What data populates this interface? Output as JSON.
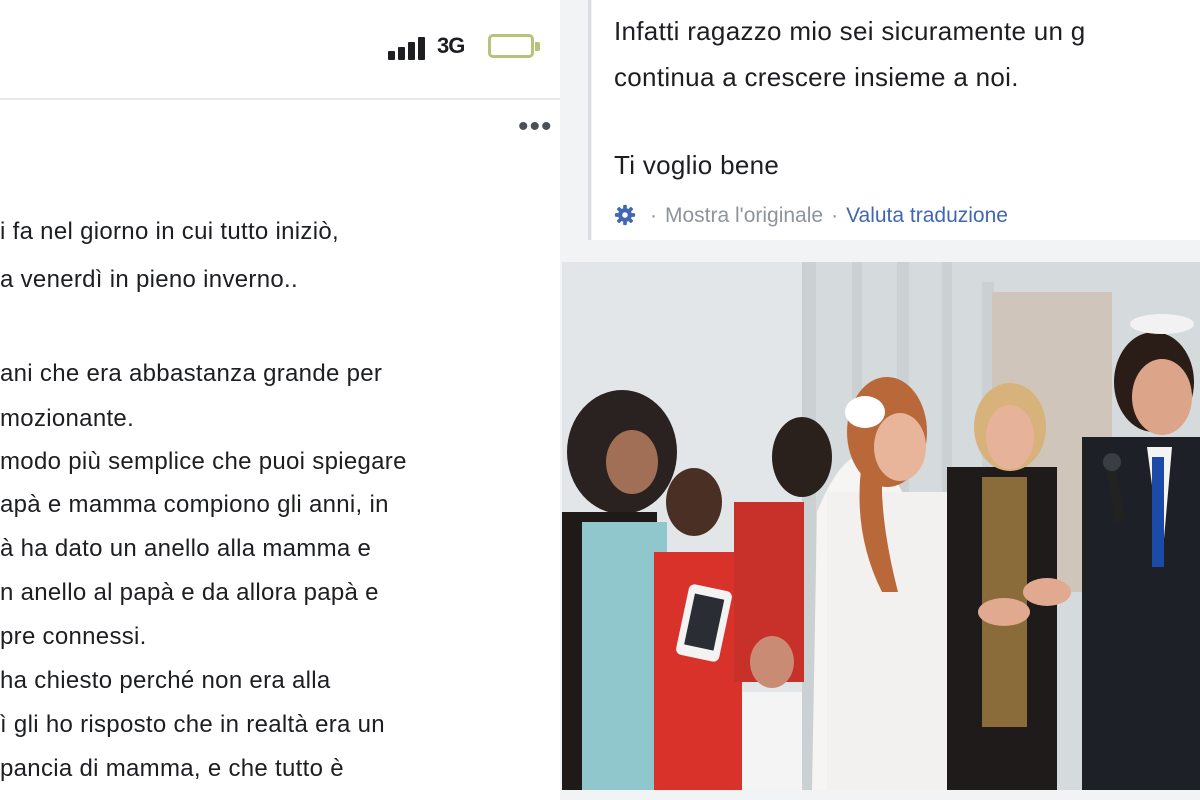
{
  "status_bar": {
    "network": "3G",
    "signal_bars": 4,
    "battery_level": 0.1,
    "icons": [
      "signal-icon",
      "battery-icon"
    ]
  },
  "post": {
    "more_icon": "•••",
    "lines": [
      "i fa nel giorno in cui tutto iniziò,",
      "a venerdì in pieno inverno..",
      "",
      "ani che era abbastanza grande per",
      "mozionante.",
      "modo più semplice che puoi spiegare",
      "apà e mamma compiono gli anni, in",
      "à ha dato un anello alla mamma e",
      "n anello al papà e da allora papà e",
      "pre connessi.",
      "ha chiesto perché non era alla",
      "ì gli ho risposto che in realtà era un",
      "pancia di mamma, e che tutto è"
    ]
  },
  "comment": {
    "lines": [
      "Infatti ragazzo mio sei sicuramente un g",
      "continua a crescere insieme a noi.",
      "",
      "Ti voglio bene"
    ],
    "translation": {
      "icon": "gear-icon",
      "separator": "·",
      "show_original": "Mostra l'originale",
      "rate_translation": "Valuta traduzione"
    }
  },
  "photo": {
    "subject": "wedding-ceremony-photo"
  },
  "colors": {
    "link_blue": "#4267b2",
    "muted_gray": "#8d949e",
    "text": "#1c1e21"
  }
}
